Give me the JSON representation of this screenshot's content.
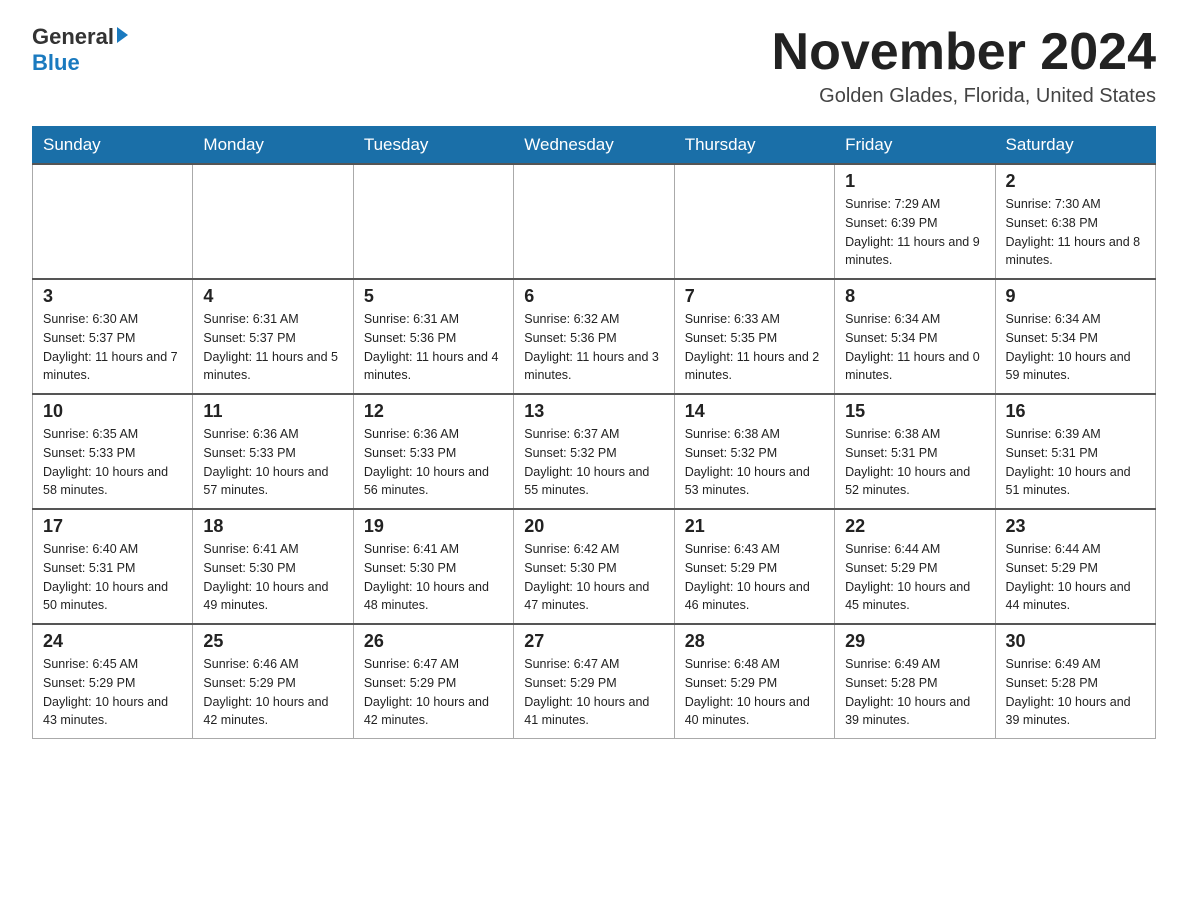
{
  "header": {
    "logo_general": "General",
    "logo_blue": "Blue",
    "month_title": "November 2024",
    "location": "Golden Glades, Florida, United States"
  },
  "weekdays": [
    "Sunday",
    "Monday",
    "Tuesday",
    "Wednesday",
    "Thursday",
    "Friday",
    "Saturday"
  ],
  "weeks": [
    [
      {
        "day": "",
        "info": ""
      },
      {
        "day": "",
        "info": ""
      },
      {
        "day": "",
        "info": ""
      },
      {
        "day": "",
        "info": ""
      },
      {
        "day": "",
        "info": ""
      },
      {
        "day": "1",
        "info": "Sunrise: 7:29 AM\nSunset: 6:39 PM\nDaylight: 11 hours and 9 minutes."
      },
      {
        "day": "2",
        "info": "Sunrise: 7:30 AM\nSunset: 6:38 PM\nDaylight: 11 hours and 8 minutes."
      }
    ],
    [
      {
        "day": "3",
        "info": "Sunrise: 6:30 AM\nSunset: 5:37 PM\nDaylight: 11 hours and 7 minutes."
      },
      {
        "day": "4",
        "info": "Sunrise: 6:31 AM\nSunset: 5:37 PM\nDaylight: 11 hours and 5 minutes."
      },
      {
        "day": "5",
        "info": "Sunrise: 6:31 AM\nSunset: 5:36 PM\nDaylight: 11 hours and 4 minutes."
      },
      {
        "day": "6",
        "info": "Sunrise: 6:32 AM\nSunset: 5:36 PM\nDaylight: 11 hours and 3 minutes."
      },
      {
        "day": "7",
        "info": "Sunrise: 6:33 AM\nSunset: 5:35 PM\nDaylight: 11 hours and 2 minutes."
      },
      {
        "day": "8",
        "info": "Sunrise: 6:34 AM\nSunset: 5:34 PM\nDaylight: 11 hours and 0 minutes."
      },
      {
        "day": "9",
        "info": "Sunrise: 6:34 AM\nSunset: 5:34 PM\nDaylight: 10 hours and 59 minutes."
      }
    ],
    [
      {
        "day": "10",
        "info": "Sunrise: 6:35 AM\nSunset: 5:33 PM\nDaylight: 10 hours and 58 minutes."
      },
      {
        "day": "11",
        "info": "Sunrise: 6:36 AM\nSunset: 5:33 PM\nDaylight: 10 hours and 57 minutes."
      },
      {
        "day": "12",
        "info": "Sunrise: 6:36 AM\nSunset: 5:33 PM\nDaylight: 10 hours and 56 minutes."
      },
      {
        "day": "13",
        "info": "Sunrise: 6:37 AM\nSunset: 5:32 PM\nDaylight: 10 hours and 55 minutes."
      },
      {
        "day": "14",
        "info": "Sunrise: 6:38 AM\nSunset: 5:32 PM\nDaylight: 10 hours and 53 minutes."
      },
      {
        "day": "15",
        "info": "Sunrise: 6:38 AM\nSunset: 5:31 PM\nDaylight: 10 hours and 52 minutes."
      },
      {
        "day": "16",
        "info": "Sunrise: 6:39 AM\nSunset: 5:31 PM\nDaylight: 10 hours and 51 minutes."
      }
    ],
    [
      {
        "day": "17",
        "info": "Sunrise: 6:40 AM\nSunset: 5:31 PM\nDaylight: 10 hours and 50 minutes."
      },
      {
        "day": "18",
        "info": "Sunrise: 6:41 AM\nSunset: 5:30 PM\nDaylight: 10 hours and 49 minutes."
      },
      {
        "day": "19",
        "info": "Sunrise: 6:41 AM\nSunset: 5:30 PM\nDaylight: 10 hours and 48 minutes."
      },
      {
        "day": "20",
        "info": "Sunrise: 6:42 AM\nSunset: 5:30 PM\nDaylight: 10 hours and 47 minutes."
      },
      {
        "day": "21",
        "info": "Sunrise: 6:43 AM\nSunset: 5:29 PM\nDaylight: 10 hours and 46 minutes."
      },
      {
        "day": "22",
        "info": "Sunrise: 6:44 AM\nSunset: 5:29 PM\nDaylight: 10 hours and 45 minutes."
      },
      {
        "day": "23",
        "info": "Sunrise: 6:44 AM\nSunset: 5:29 PM\nDaylight: 10 hours and 44 minutes."
      }
    ],
    [
      {
        "day": "24",
        "info": "Sunrise: 6:45 AM\nSunset: 5:29 PM\nDaylight: 10 hours and 43 minutes."
      },
      {
        "day": "25",
        "info": "Sunrise: 6:46 AM\nSunset: 5:29 PM\nDaylight: 10 hours and 42 minutes."
      },
      {
        "day": "26",
        "info": "Sunrise: 6:47 AM\nSunset: 5:29 PM\nDaylight: 10 hours and 42 minutes."
      },
      {
        "day": "27",
        "info": "Sunrise: 6:47 AM\nSunset: 5:29 PM\nDaylight: 10 hours and 41 minutes."
      },
      {
        "day": "28",
        "info": "Sunrise: 6:48 AM\nSunset: 5:29 PM\nDaylight: 10 hours and 40 minutes."
      },
      {
        "day": "29",
        "info": "Sunrise: 6:49 AM\nSunset: 5:28 PM\nDaylight: 10 hours and 39 minutes."
      },
      {
        "day": "30",
        "info": "Sunrise: 6:49 AM\nSunset: 5:28 PM\nDaylight: 10 hours and 39 minutes."
      }
    ]
  ]
}
